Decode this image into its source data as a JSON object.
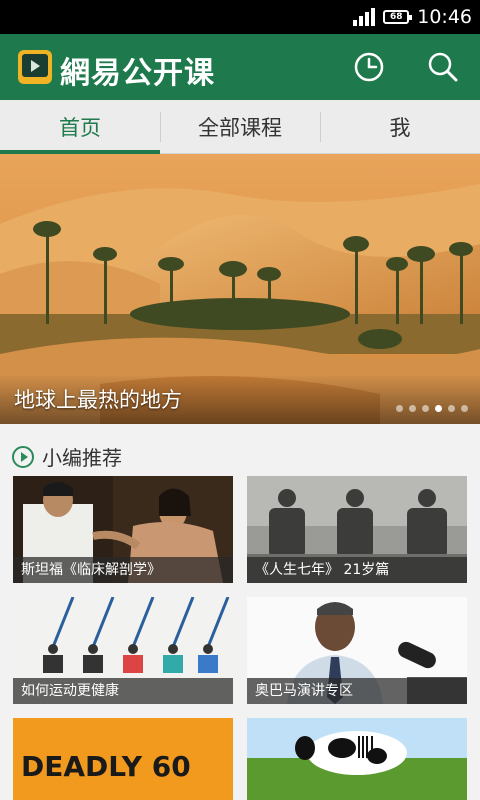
{
  "status": {
    "battery": "68",
    "time": "10:46"
  },
  "appbar": {
    "title": "網易公开课"
  },
  "tabs": [
    {
      "label": "首页",
      "active": true
    },
    {
      "label": "全部课程",
      "active": false
    },
    {
      "label": "我",
      "active": false
    }
  ],
  "banner": {
    "caption": "地球上最热的地方",
    "dot_count": 6,
    "active_dot": 3
  },
  "recommend": {
    "title": "小编推荐",
    "items": [
      {
        "label": "斯坦福《临床解剖学》"
      },
      {
        "label": "《人生七年》 21岁篇"
      },
      {
        "label": "如何运动更健康"
      },
      {
        "label": "奥巴马演讲专区"
      },
      {
        "label": ""
      },
      {
        "label": ""
      }
    ]
  },
  "card5_art_text": "DEADLY 60",
  "colors": {
    "primary": "#1e7a4c",
    "tab_bg": "#ececec",
    "background": "#f2f2f2"
  },
  "icons": [
    "signal-icon",
    "battery-icon",
    "app-logo-icon",
    "history-clock-icon",
    "search-icon",
    "play-circle-icon"
  ]
}
